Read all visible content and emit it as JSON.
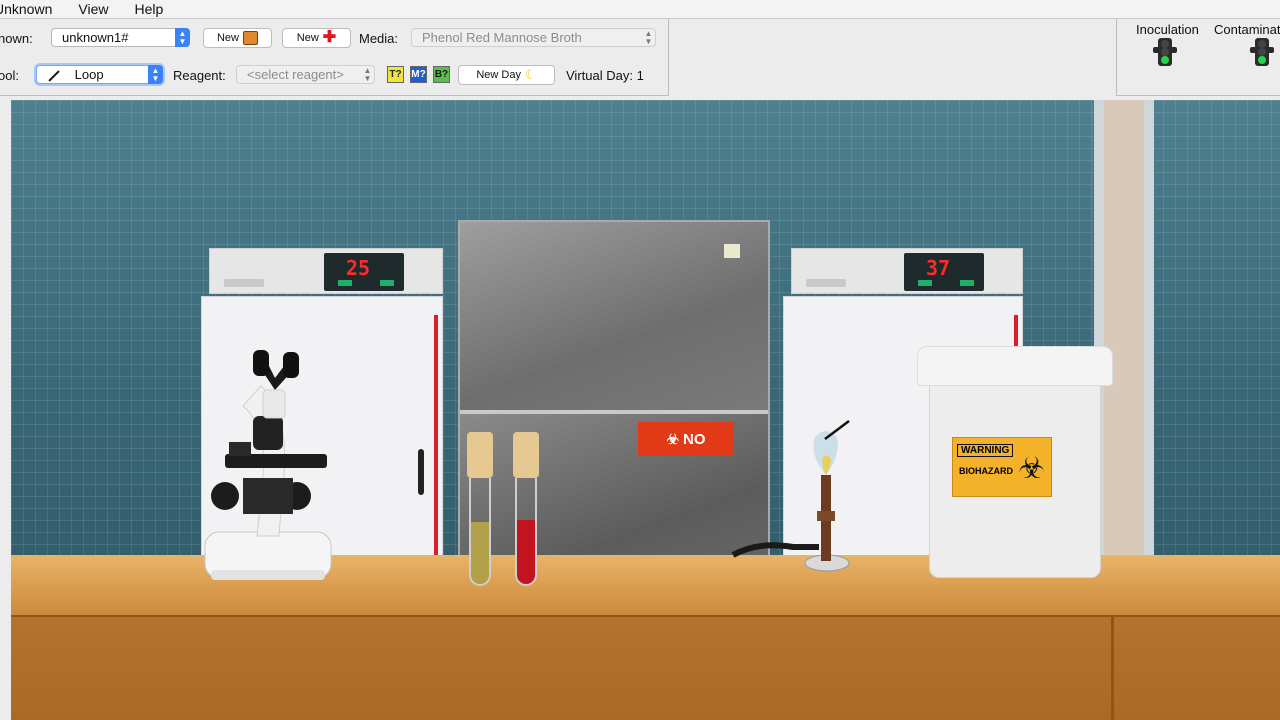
{
  "menu": [
    "Unknown",
    "View",
    "Help"
  ],
  "toolbar": {
    "unknown_label": "nown:",
    "unknown_value": "unknown1#",
    "new_unknown_label": "New",
    "new_media_label": "New",
    "media_label": "Media:",
    "media_value": "Phenol Red Mannose Broth",
    "tool_label": "ool:",
    "tool_value": "Loop",
    "reagent_label": "Reagent:",
    "reagent_value": "<select reagent>",
    "mini_buttons": [
      "T?",
      "M?",
      "B?"
    ],
    "new_day_label": "New Day",
    "virtual_day": "Virtual Day: 1"
  },
  "indicators": {
    "inoculation": "Inoculation",
    "contamination": "Contaminat"
  },
  "scene": {
    "incubator_left_temp": "25",
    "incubator_right_temp": "37",
    "fridge_sign_text": "NO",
    "bin_warning": "WARNING",
    "bin_biohazard": "BIOHAZARD"
  },
  "colors": {
    "tube_left_fill": "#b2a04a",
    "tube_right_fill": "#c2141e",
    "accent": "#3b82f6"
  }
}
